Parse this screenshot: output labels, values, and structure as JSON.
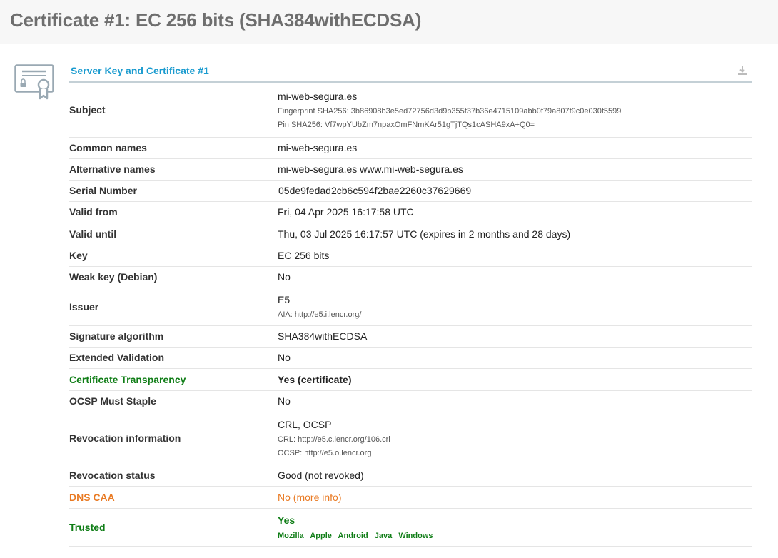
{
  "page": {
    "title": "Certificate #1: EC 256 bits (SHA384withECDSA)"
  },
  "section": {
    "title": "Server Key and Certificate #1"
  },
  "rows": {
    "subject": {
      "label": "Subject",
      "value": "mi-web-segura.es",
      "fingerprint": "Fingerprint SHA256: 3b86908b3e5ed72756d3d9b355f37b36e4715109abb0f79a807f9c0e030f5599",
      "pin": "Pin SHA256: Vf7wpYUbZm7npaxOmFNmKAr51gTjTQs1cASHA9xA+Q0="
    },
    "common_names": {
      "label": "Common names",
      "value": "mi-web-segura.es"
    },
    "alt_names": {
      "label": "Alternative names",
      "value": "mi-web-segura.es www.mi-web-segura.es"
    },
    "serial": {
      "label": "Serial Number",
      "value": "05de9fedad2cb6c594f2bae2260c37629669"
    },
    "valid_from": {
      "label": "Valid from",
      "value": "Fri, 04 Apr 2025 16:17:58 UTC"
    },
    "valid_until": {
      "label": "Valid until",
      "value": "Thu, 03 Jul 2025 16:17:57 UTC (expires in 2 months and 28 days)"
    },
    "key": {
      "label": "Key",
      "value": "EC 256 bits"
    },
    "weak_key": {
      "label": "Weak key (Debian)",
      "value": "No"
    },
    "issuer": {
      "label": "Issuer",
      "value": "E5",
      "aia": "AIA: http://e5.i.lencr.org/"
    },
    "sig_alg": {
      "label": "Signature algorithm",
      "value": "SHA384withECDSA"
    },
    "ev": {
      "label": "Extended Validation",
      "value": "No"
    },
    "ct": {
      "label": "Certificate Transparency",
      "value": "Yes (certificate)"
    },
    "ocsp_staple": {
      "label": "OCSP Must Staple",
      "value": "No"
    },
    "revocation_info": {
      "label": "Revocation information",
      "value": "CRL, OCSP",
      "crl": "CRL: http://e5.c.lencr.org/106.crl",
      "ocsp": "OCSP: http://e5.o.lencr.org"
    },
    "revocation_status": {
      "label": "Revocation status",
      "value": "Good (not revoked)"
    },
    "dns_caa": {
      "label": "DNS CAA",
      "value": "No",
      "link": "(more info)"
    },
    "trusted": {
      "label": "Trusted",
      "value": "Yes",
      "stores": [
        "Mozilla",
        "Apple",
        "Android",
        "Java",
        "Windows"
      ]
    }
  },
  "colors": {
    "green": "#0f7d16",
    "orange": "#e97a23",
    "section_title": "#1a9bcf"
  },
  "icons": {
    "certificate": "certificate-icon",
    "download": "download-icon"
  }
}
